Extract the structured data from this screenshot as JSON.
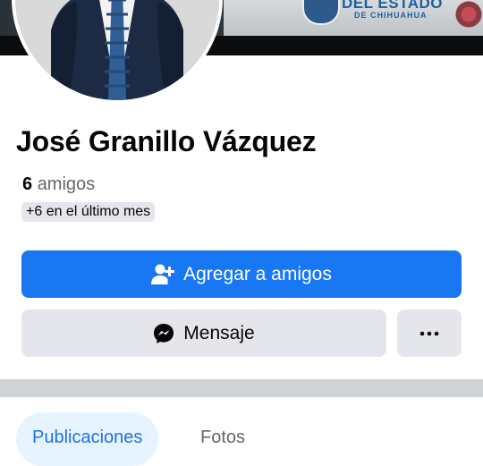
{
  "cover": {
    "text_line1": "DEL ESTADO",
    "text_line2": "DE CHIHUAHUA"
  },
  "profile": {
    "name": "José Granillo Vázquez",
    "friends_count": "6",
    "friends_label": "amigos",
    "friends_recent": "+6 en el último mes"
  },
  "actions": {
    "add_friend_label": "Agregar a amigos",
    "message_label": "Mensaje",
    "more_label": "···"
  },
  "tabs": [
    {
      "label": "Publicaciones",
      "active": true
    },
    {
      "label": "Fotos",
      "active": false
    }
  ],
  "colors": {
    "primary": "#1877f2",
    "secondary_bg": "#e4e6eb",
    "tab_active_bg": "#e7f3ff",
    "tab_active_text": "#1b74e4"
  }
}
